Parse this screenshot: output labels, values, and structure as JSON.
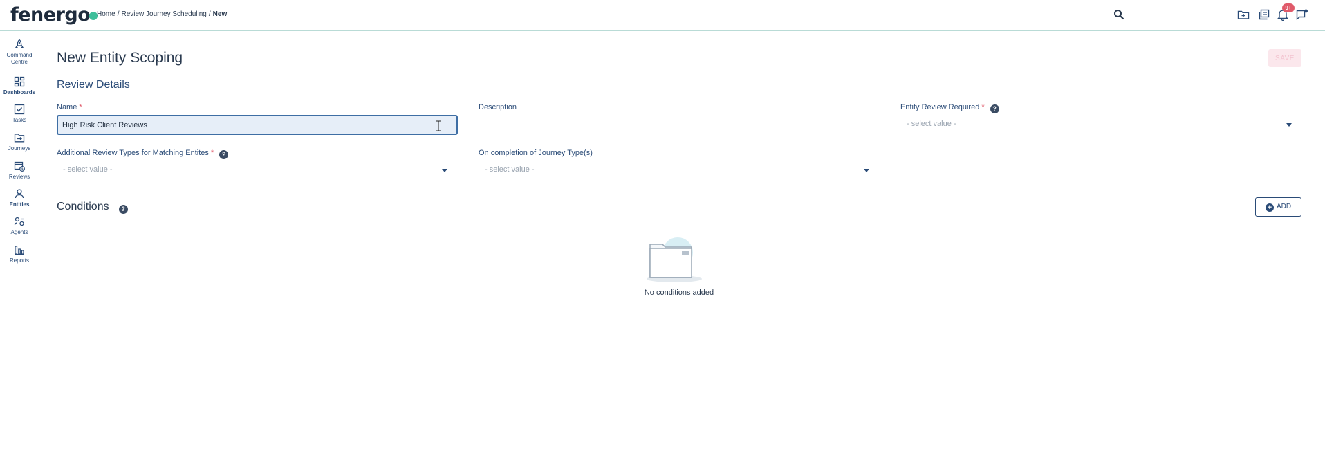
{
  "brand": {
    "logo_text": "fenergo",
    "accent": "#3fbf9b"
  },
  "breadcrumb": {
    "items": [
      "Home",
      "Review Journey Scheduling",
      "New"
    ],
    "separator": "/"
  },
  "topbar": {
    "icons": [
      "search-icon",
      "folder-add-icon",
      "copy-icon",
      "bell-icon",
      "message-icon"
    ],
    "notification_badge": "9+"
  },
  "sidebar": {
    "items": [
      {
        "label": "Command Centre",
        "icon": "rocket-icon"
      },
      {
        "label": "Dashboards",
        "icon": "dashboard-icon"
      },
      {
        "label": "Tasks",
        "icon": "checkbox-icon"
      },
      {
        "label": "Journeys",
        "icon": "folder-arrow-icon"
      },
      {
        "label": "Reviews",
        "icon": "calendar-clock-icon"
      },
      {
        "label": "Entities",
        "icon": "person-icon"
      },
      {
        "label": "Agents",
        "icon": "agents-icon"
      },
      {
        "label": "Reports",
        "icon": "bar-chart-icon"
      }
    ]
  },
  "page": {
    "title": "New Entity Scoping",
    "save_label": "SAVE",
    "review_details_title": "Review Details",
    "fields": {
      "name": {
        "label": "Name",
        "value": "High Risk Client Reviews",
        "required": true
      },
      "description": {
        "label": "Description"
      },
      "entity_review_required": {
        "label": "Entity Review Required",
        "placeholder": "- select value -",
        "required": true
      },
      "additional_review_types": {
        "label": "Additional Review Types for Matching Entites",
        "placeholder": "- select value -",
        "required": true
      },
      "on_completion": {
        "label": "On completion of Journey Type(s)",
        "placeholder": "- select value -"
      }
    },
    "required_marker": "*",
    "help_glyph": "?",
    "conditions": {
      "title": "Conditions",
      "add_label": "ADD",
      "empty_text": "No conditions added"
    }
  },
  "colors": {
    "primary": "#2a4b77",
    "required": "#e05a6a",
    "save_disabled_bg": "#fbe7ec"
  }
}
